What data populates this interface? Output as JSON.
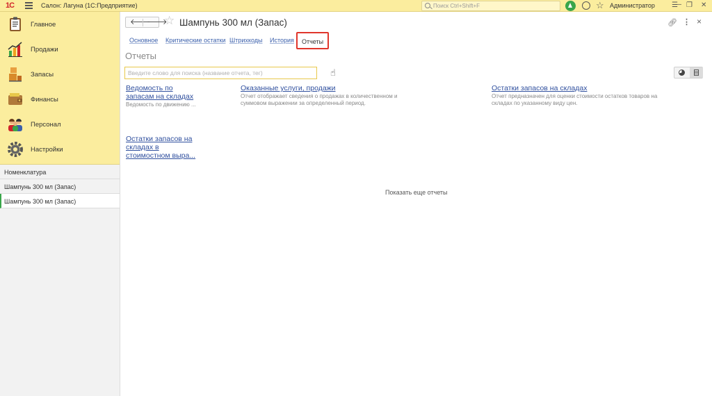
{
  "topbar": {
    "logo": "1С",
    "app_title": "Салон: Лагуна  (1С:Предприятие)",
    "search_placeholder": "Поиск Ctrl+Shift+F",
    "user": "Администратор",
    "menu_icon": "hamburger-icon",
    "window_controls": [
      "☰",
      "—",
      "❐",
      "✕"
    ]
  },
  "sidebar": {
    "nav": [
      {
        "label": "Главное",
        "icon": "clipboard-icon"
      },
      {
        "label": "Продажи",
        "icon": "chart-icon"
      },
      {
        "label": "Запасы",
        "icon": "box-icon"
      },
      {
        "label": "Финансы",
        "icon": "wallet-icon"
      },
      {
        "label": "Персонал",
        "icon": "people-icon"
      },
      {
        "label": "Настройки",
        "icon": "gear-icon"
      }
    ],
    "open_windows": [
      {
        "label": "Номенклатура"
      },
      {
        "label": "Шампунь 300 мл (Запас)"
      },
      {
        "label": "Шампунь 300 мл (Запас)"
      }
    ]
  },
  "main": {
    "back": "🡐",
    "forward": "🡒",
    "title": "Шампунь 300 мл (Запас)",
    "tabs": [
      "Основное",
      "Критические остатки",
      "Штрихкоды",
      "История",
      "Отчеты"
    ],
    "active_tab": "Отчеты",
    "section_title": "Отчеты",
    "search_placeholder": "Введите слово для поиска (название отчета, тег)",
    "reports": [
      {
        "title": "Ведомость по запасам на складах",
        "desc": "Ведомость по движению ..."
      },
      {
        "title": "Оказанные услуги, продажи",
        "desc": "Отчет отображает сведения о продажах в количественном и суммовом выражении за определенный период."
      },
      {
        "title": "Остатки запасов на складах",
        "desc": "Отчет предназначен для оценки стоимости остатков товаров на складах по указанному виду цен."
      },
      {
        "title": "Остатки запасов на складах в стоимостном выра...",
        "desc": ""
      }
    ],
    "show_more": "Показать еще отчеты"
  },
  "colors": {
    "accent_yellow": "#fbed9e",
    "link_blue": "#2f4f9e",
    "highlight_red": "#e0352b",
    "green": "#3aa64a"
  }
}
